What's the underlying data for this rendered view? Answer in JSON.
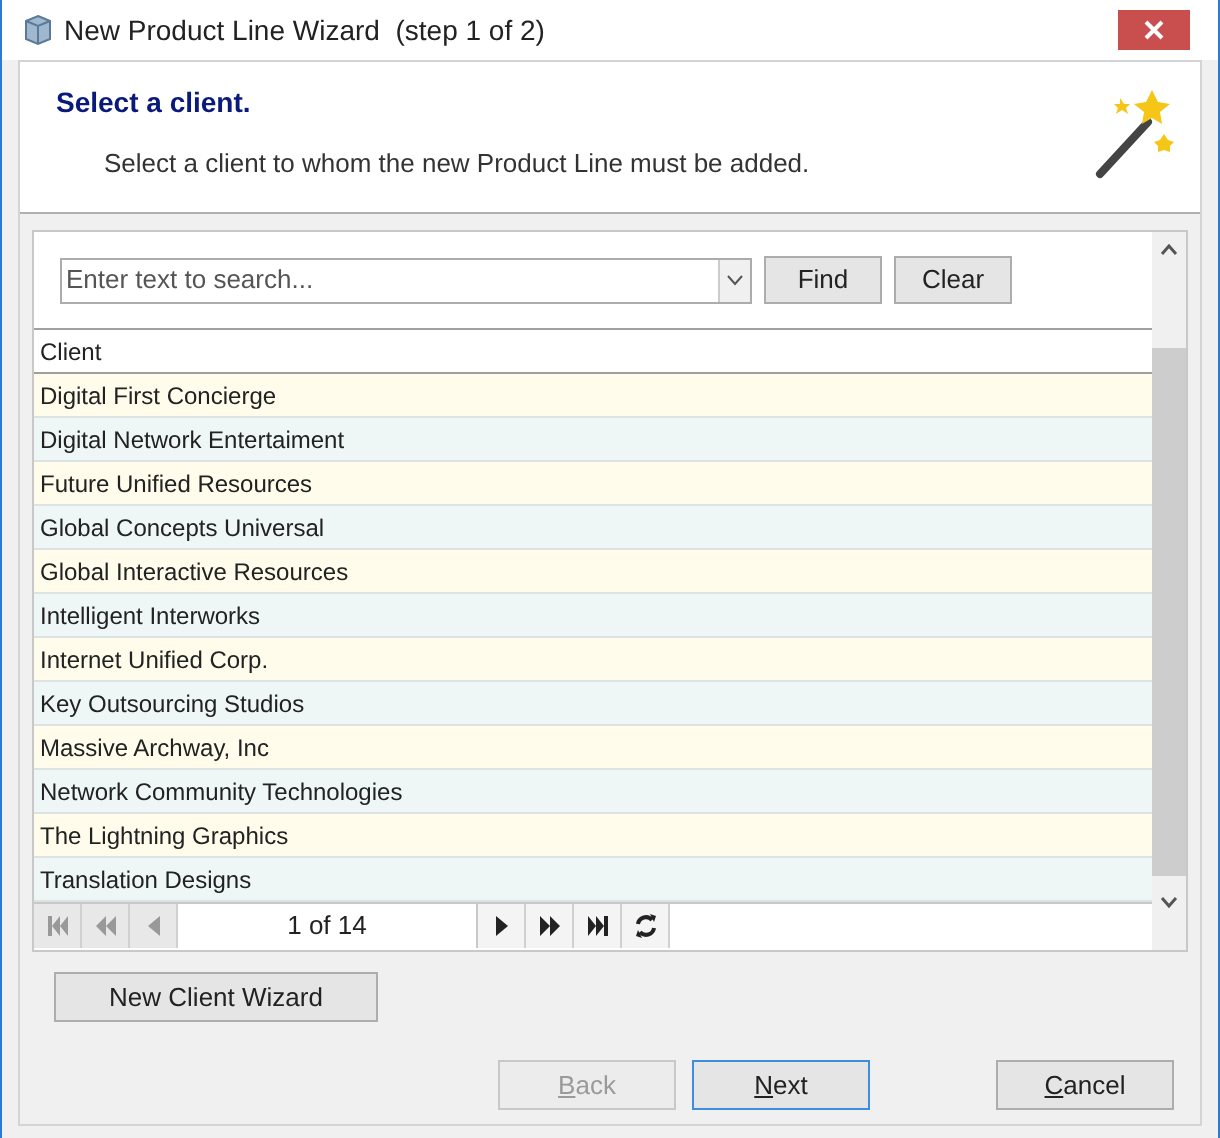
{
  "window": {
    "title": "New Product Line Wizard  (step 1 of 2)"
  },
  "header": {
    "title": "Select a client.",
    "subtitle": "Select a client to whom the new Product Line must be added."
  },
  "search": {
    "placeholder": "Enter text to search...",
    "buttons": [
      "Find",
      "Clear"
    ]
  },
  "table": {
    "columns": [
      "Client"
    ],
    "rows": [
      "Digital First Concierge",
      "Digital Network Entertaiment",
      "Future Unified Resources",
      "Global Concepts Universal",
      "Global Interactive Resources",
      "Intelligent Interworks",
      "Internet Unified Corp.",
      "Key Outsourcing Studios",
      "Massive Archway, Inc",
      "Network Community Technologies",
      "The Lightning Graphics",
      "Translation Designs"
    ]
  },
  "pager": {
    "text": "1 of 14"
  },
  "new_client_button": "New Client Wizard",
  "footer_buttons": [
    {
      "label": "Back",
      "disabled": true,
      "default": false,
      "mnemonic": true
    },
    {
      "label": "Next",
      "disabled": false,
      "default": true,
      "mnemonic": true
    },
    {
      "label": "Cancel",
      "disabled": false,
      "default": false,
      "mnemonic": true
    }
  ]
}
